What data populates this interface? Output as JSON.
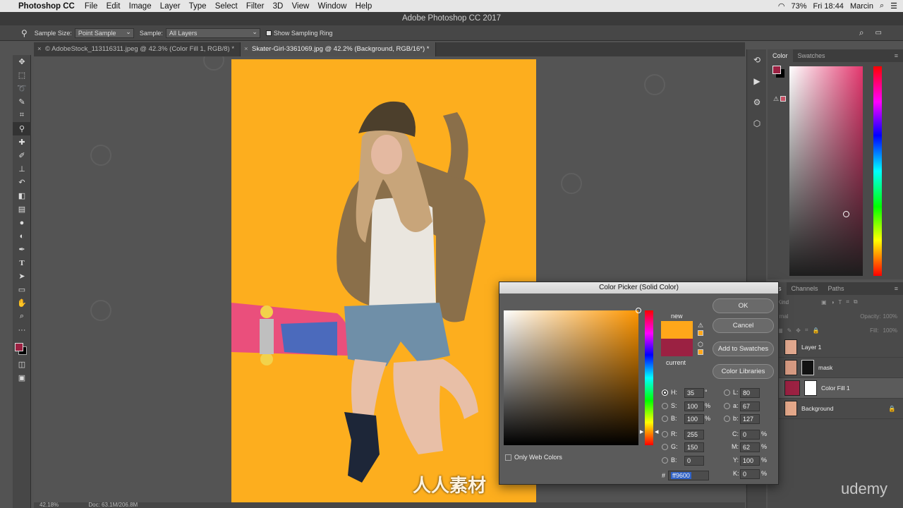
{
  "mac_menu": {
    "app_name": "Photoshop CC",
    "items": [
      "File",
      "Edit",
      "Image",
      "Layer",
      "Type",
      "Select",
      "Filter",
      "3D",
      "View",
      "Window",
      "Help"
    ],
    "battery": "73%",
    "clock": "Fri 18:44",
    "user": "Marcin"
  },
  "window_title": "Adobe Photoshop CC 2017",
  "options_bar": {
    "sample_size_label": "Sample Size:",
    "sample_size_value": "Point Sample",
    "sample_label": "Sample:",
    "sample_value": "All Layers",
    "show_ring_label": "Show Sampling Ring"
  },
  "tabs": [
    {
      "label": "© AdobeStock_113116311.jpeg @ 42.3% (Color Fill 1, RGB/8) *"
    },
    {
      "label": "Skater-Girl-3361069.jpg @ 42.2% (Background, RGB/16*) *"
    }
  ],
  "status_bar": {
    "zoom": "42.18%",
    "doc": "Doc: 63.1M/206.8M"
  },
  "color_panel": {
    "tab_color": "Color",
    "tab_swatches": "Swatches"
  },
  "layers_panel": {
    "tab_layers": "ers",
    "tab_channels": "Channels",
    "tab_paths": "Paths",
    "kind": "Kind",
    "blend": "rmal",
    "opacity_label": "Opacity:",
    "opacity_value": "100%",
    "fill_label": "Fill:",
    "fill_value": "100%",
    "layers": [
      {
        "name": "Layer 1"
      },
      {
        "name": "mask"
      },
      {
        "name": "Color Fill 1"
      },
      {
        "name": "Background"
      }
    ]
  },
  "color_picker": {
    "title": "Color Picker (Solid Color)",
    "new_label": "new",
    "current_label": "current",
    "new_color": "#ffa71a",
    "current_color": "#9b2142",
    "buttons": {
      "ok": "OK",
      "cancel": "Cancel",
      "add_swatches": "Add to Swatches",
      "libraries": "Color Libraries"
    },
    "only_web": "Only Web Colors",
    "H": "35",
    "S": "100",
    "B": "100",
    "R": "255",
    "G": "150",
    "Bv": "0",
    "L": "80",
    "a": "67",
    "b": "127",
    "C": "0",
    "M": "62",
    "Y": "100",
    "K": "0",
    "hex": "ff9600",
    "deg": "°",
    "pct": "%"
  },
  "foreground_color": "#9b2142",
  "watermarks": {
    "logo_text": "人人素材",
    "udemy": "udemy"
  }
}
